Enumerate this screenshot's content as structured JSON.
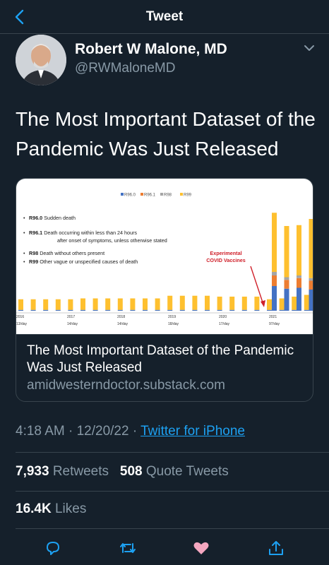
{
  "header": {
    "title": "Tweet",
    "back_icon": "chevron-left-icon"
  },
  "author": {
    "name": "Robert W Malone, MD",
    "handle": "@RWMaloneMD"
  },
  "tweet": {
    "text": "The Most Important Dataset of the Pandemic Was Just Released"
  },
  "card": {
    "title": "The Most Important Dataset of the Pandemic Was Just Released",
    "domain": "amidwesterndoctor.substack.com"
  },
  "meta": {
    "time": "4:18 AM",
    "date": "12/20/22",
    "separator": "·",
    "source": "Twitter for iPhone"
  },
  "stats": {
    "retweets": "7,933",
    "retweets_label": "Retweets",
    "quotes": "508",
    "quotes_label": "Quote Tweets",
    "likes": "16.4K",
    "likes_label": "Likes"
  },
  "actions": [
    "reply-icon",
    "retweet-icon",
    "like-icon",
    "share-icon"
  ],
  "colors": {
    "accent": "#1da1f2",
    "background": "#15202b",
    "like": "#f4a7c0"
  },
  "chart_data": {
    "type": "bar",
    "legend": [
      "R96.0",
      "R96.1",
      "R98",
      "R99"
    ],
    "colors": [
      "#4472c4",
      "#ed7d31",
      "#a5a5a5",
      "#fec02f"
    ],
    "definitions": [
      {
        "code": "R96.0",
        "text": "Sudden death"
      },
      {
        "code": "R96.1",
        "text": "Death occurring within less than 24 hours"
      },
      {
        "code": "",
        "text": "after onset of symptoms, unless otherwise stated"
      },
      {
        "code": "R98",
        "text": "Death without others present"
      },
      {
        "code": "R99",
        "text": "Other vague or unspecified causes of death"
      }
    ],
    "year_labels": [
      "2016",
      "2017",
      "2018",
      "2019",
      "2020",
      "2021"
    ],
    "rate_labels": [
      "13/day",
      "14/day",
      "14/day",
      "18/day",
      "17/day",
      "97/day"
    ],
    "annotation": [
      "Experimental",
      "COVID Vaccines"
    ],
    "series": [
      {
        "name": "R96.0",
        "values": [
          1,
          1,
          1,
          1,
          1,
          1,
          1,
          1,
          1,
          1,
          1,
          1,
          1,
          1,
          1,
          1,
          1,
          1,
          1,
          1,
          1,
          1,
          1,
          1,
          1,
          1,
          1,
          1,
          1,
          1,
          1,
          1,
          1,
          1,
          1,
          1,
          1,
          1,
          1,
          1,
          1,
          1,
          1,
          1,
          1,
          1,
          1,
          1,
          1,
          1,
          1,
          1,
          1,
          1,
          1,
          1,
          1,
          1,
          1,
          1,
          1,
          1,
          1,
          1,
          1,
          1,
          1,
          1,
          1,
          1,
          28,
          25,
          26,
          24
        ]
      },
      {
        "name": "R96.1",
        "values": [
          0,
          0,
          0,
          0,
          0,
          0,
          0,
          0,
          0,
          0,
          0,
          0,
          0,
          0,
          0,
          0,
          0,
          0,
          0,
          0,
          0,
          0,
          0,
          0,
          0,
          0,
          0,
          0,
          0,
          0,
          0,
          0,
          0,
          0,
          0,
          0,
          0,
          0,
          0,
          0,
          0,
          0,
          0,
          0,
          0,
          0,
          0,
          0,
          0,
          0,
          0,
          0,
          0,
          0,
          0,
          0,
          0,
          0,
          0,
          0,
          0,
          0,
          0,
          0,
          0,
          0,
          0,
          0,
          0,
          0,
          12,
          10,
          11,
          10
        ]
      },
      {
        "name": "R98",
        "values": [
          0,
          0,
          0,
          0,
          0,
          0,
          0,
          0,
          0,
          0,
          0,
          0,
          0,
          0,
          0,
          0,
          0,
          0,
          0,
          0,
          0,
          0,
          0,
          0,
          0,
          0,
          0,
          0,
          0,
          0,
          0,
          0,
          0,
          0,
          0,
          0,
          0,
          0,
          0,
          0,
          0,
          0,
          0,
          0,
          0,
          0,
          0,
          0,
          0,
          0,
          0,
          0,
          0,
          0,
          0,
          0,
          0,
          0,
          0,
          0,
          0,
          0,
          0,
          0,
          0,
          0,
          0,
          0,
          0,
          0,
          4,
          3,
          3,
          3
        ]
      },
      {
        "name": "R99",
        "values": [
          12,
          12,
          12,
          12,
          12,
          12,
          12,
          12,
          12,
          12,
          12,
          12,
          12,
          13,
          13,
          13,
          13,
          13,
          13,
          13,
          13,
          13,
          13,
          13,
          13,
          13,
          13,
          13,
          13,
          13,
          13,
          13,
          13,
          13,
          13,
          13,
          16,
          16,
          16,
          16,
          16,
          16,
          16,
          16,
          16,
          16,
          16,
          16,
          15,
          15,
          15,
          15,
          15,
          15,
          15,
          15,
          15,
          15,
          15,
          15,
          12,
          12,
          13,
          13,
          14,
          14,
          15,
          15,
          16,
          17,
          67,
          58,
          57,
          67
        ]
      }
    ]
  }
}
